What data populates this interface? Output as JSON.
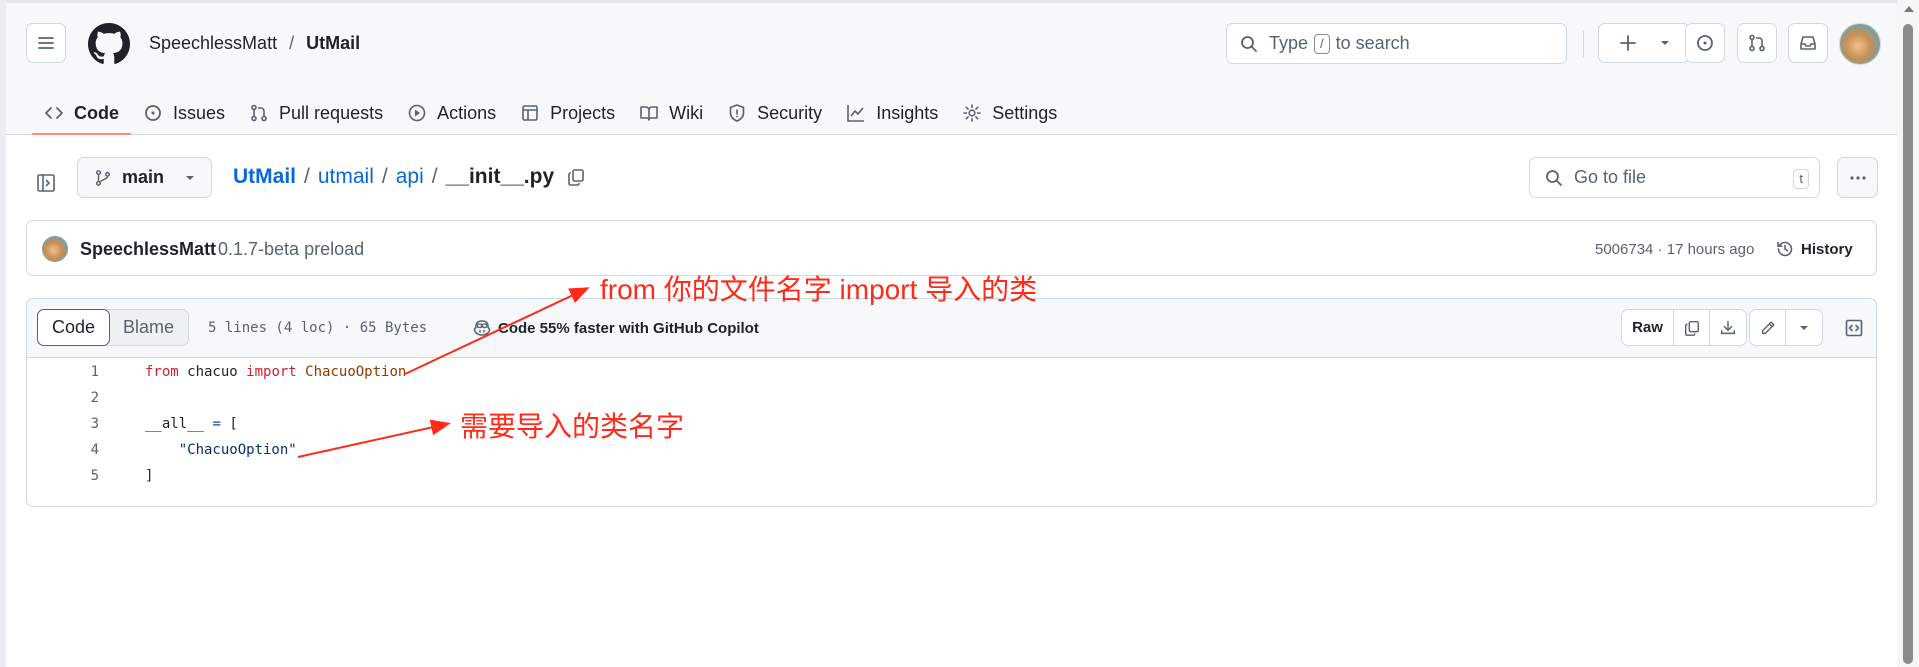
{
  "header": {
    "owner": "SpeechlessMatt",
    "separator": "/",
    "repo": "UtMail",
    "search": {
      "prefix": "Type",
      "key": "/",
      "suffix": "to search"
    }
  },
  "repo_nav": {
    "tabs": [
      {
        "label": "Code",
        "icon": "code-icon",
        "active": true
      },
      {
        "label": "Issues",
        "icon": "issue-icon",
        "active": false
      },
      {
        "label": "Pull requests",
        "icon": "pull-request-icon",
        "active": false
      },
      {
        "label": "Actions",
        "icon": "play-icon",
        "active": false
      },
      {
        "label": "Projects",
        "icon": "table-icon",
        "active": false
      },
      {
        "label": "Wiki",
        "icon": "book-icon",
        "active": false
      },
      {
        "label": "Security",
        "icon": "shield-icon",
        "active": false
      },
      {
        "label": "Insights",
        "icon": "graph-icon",
        "active": false
      },
      {
        "label": "Settings",
        "icon": "gear-icon",
        "active": false
      }
    ]
  },
  "file_bar": {
    "branch": "main",
    "path": [
      "UtMail",
      "utmail",
      "api"
    ],
    "path_separator": "/",
    "file": "__init__.py",
    "goto_placeholder": "Go to file",
    "goto_key": "t"
  },
  "commit": {
    "author": "SpeechlessMatt",
    "message": "0.1.7-beta preload",
    "meta": "5006734 · 17 hours ago",
    "history_label": "History"
  },
  "file_viewer": {
    "tabs": {
      "code": "Code",
      "blame": "Blame"
    },
    "stats": "5 lines (4 loc) · 65 Bytes",
    "copilot": "Code 55% faster with GitHub Copilot",
    "raw_label": "Raw",
    "lines": [
      {
        "num": "1",
        "tokens": [
          {
            "t": "from",
            "c": "kw"
          },
          {
            "t": " chacuo ",
            "c": ""
          },
          {
            "t": "import",
            "c": "kw"
          },
          {
            "t": " ",
            "c": ""
          },
          {
            "t": "ChacuoOption",
            "c": "fn"
          }
        ]
      },
      {
        "num": "2",
        "tokens": []
      },
      {
        "num": "3",
        "tokens": [
          {
            "t": "__all__",
            "c": ""
          },
          {
            "t": " ",
            "c": ""
          },
          {
            "t": "=",
            "c": "op"
          },
          {
            "t": " [",
            "c": ""
          }
        ]
      },
      {
        "num": "4",
        "tokens": [
          {
            "t": "    ",
            "c": ""
          },
          {
            "t": "\"ChacuoOption\"",
            "c": "str"
          }
        ]
      },
      {
        "num": "5",
        "tokens": [
          {
            "t": "]",
            "c": ""
          }
        ]
      }
    ]
  },
  "annotations": {
    "first": "from 你的文件名字 import 导入的类",
    "second": "需要导入的类名字",
    "color": "#ff2a1a"
  },
  "colors": {
    "link": "#0969da",
    "active_tab_underline": "#fd8c73",
    "header_bg": "#f6f8fa"
  }
}
